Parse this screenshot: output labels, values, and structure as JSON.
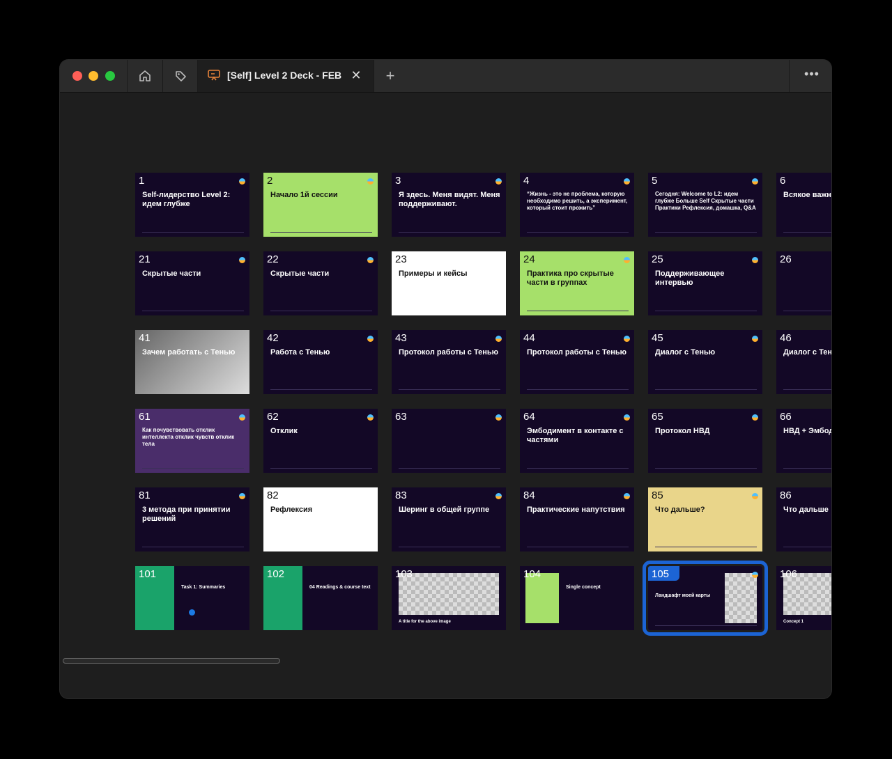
{
  "tab": {
    "title": "[Self] Level 2 Deck - FEB"
  },
  "icons": {
    "home": "home-icon",
    "tag": "tag-icon",
    "tab": "presentation-icon",
    "close": "close-icon",
    "add": "plus-icon",
    "more": "more-icon"
  },
  "colors": {
    "selection": "#1c64d4",
    "green_slide": "#a6e06a",
    "teal_panel": "#1aa36a"
  },
  "rows": [
    [
      {
        "num": "1",
        "title": "Self-лидерство Level 2: идем глубже",
        "style": "dark"
      },
      {
        "num": "2",
        "title": "Начало 1й сессии",
        "style": "green"
      },
      {
        "num": "3",
        "title": "Я здесь. Меня видят. Меня поддерживают.",
        "style": "dark"
      },
      {
        "num": "4",
        "title": "“Жизнь - это не проблема, которую необходимо решить, а эксперимент, который стоит прожить”",
        "style": "dark"
      },
      {
        "num": "5",
        "title": "Сегодня: Welcome to L2: идем глубже Больше Self Скрытые части Практики Рефлексия, домашка, Q&A",
        "style": "dark"
      },
      {
        "num": "6",
        "title": "Всякое важное в",
        "style": "dark"
      }
    ],
    [
      {
        "num": "21",
        "title": "Скрытые части",
        "style": "dark"
      },
      {
        "num": "22",
        "title": "Скрытые части",
        "style": "dark"
      },
      {
        "num": "23",
        "title": "Примеры и кейсы",
        "style": "lightbg"
      },
      {
        "num": "24",
        "title": "Практика про скрытые части в группах",
        "style": "green"
      },
      {
        "num": "25",
        "title": "Поддерживающее интервью",
        "style": "dark"
      },
      {
        "num": "26",
        "title": "",
        "style": "dark"
      }
    ],
    [
      {
        "num": "41",
        "title": "Зачем работать с Тенью",
        "style": "photo"
      },
      {
        "num": "42",
        "title": "Работа с Тенью",
        "style": "dark"
      },
      {
        "num": "43",
        "title": "Протокол работы с Тенью",
        "style": "dark"
      },
      {
        "num": "44",
        "title": "Протокол работы с Тенью",
        "style": "dark"
      },
      {
        "num": "45",
        "title": "Диалог с Тенью",
        "style": "dark"
      },
      {
        "num": "46",
        "title": "Диалог с Тенью",
        "style": "dark"
      }
    ],
    [
      {
        "num": "61",
        "title": "Как почувствовать отклик интеллекта отклик чувств отклик тела",
        "style": "purple"
      },
      {
        "num": "62",
        "title": "Отклик",
        "style": "dark"
      },
      {
        "num": "63",
        "title": "",
        "style": "dark"
      },
      {
        "num": "64",
        "title": "Эмбодимент в контакте с частями",
        "style": "dark"
      },
      {
        "num": "65",
        "title": "Протокол НВД",
        "style": "dark"
      },
      {
        "num": "66",
        "title": "НВД + Эмбодиме",
        "style": "dark"
      }
    ],
    [
      {
        "num": "81",
        "title": "3 метода при принятии решений",
        "style": "dark"
      },
      {
        "num": "82",
        "title": "Рефлексия",
        "style": "lightbg"
      },
      {
        "num": "83",
        "title": "Шеринг в общей группе",
        "style": "dark"
      },
      {
        "num": "84",
        "title": "Практические напутствия",
        "style": "dark"
      },
      {
        "num": "85",
        "title": "Что дальше?",
        "style": "yellow"
      },
      {
        "num": "86",
        "title": "Что дальше",
        "style": "dark"
      }
    ],
    [
      {
        "num": "101",
        "title": "Task 1: Summaries",
        "style": "teal"
      },
      {
        "num": "102",
        "title": "04 Readings & course text",
        "style": "teal"
      },
      {
        "num": "103",
        "title": "A title for the above image",
        "style": "checker"
      },
      {
        "num": "104",
        "title": "Single concept",
        "style": "greenpanel"
      },
      {
        "num": "105",
        "title": "Ландшафт моей карты",
        "style": "selected"
      },
      {
        "num": "106",
        "title": "Concept 1",
        "style": "checker"
      }
    ]
  ]
}
